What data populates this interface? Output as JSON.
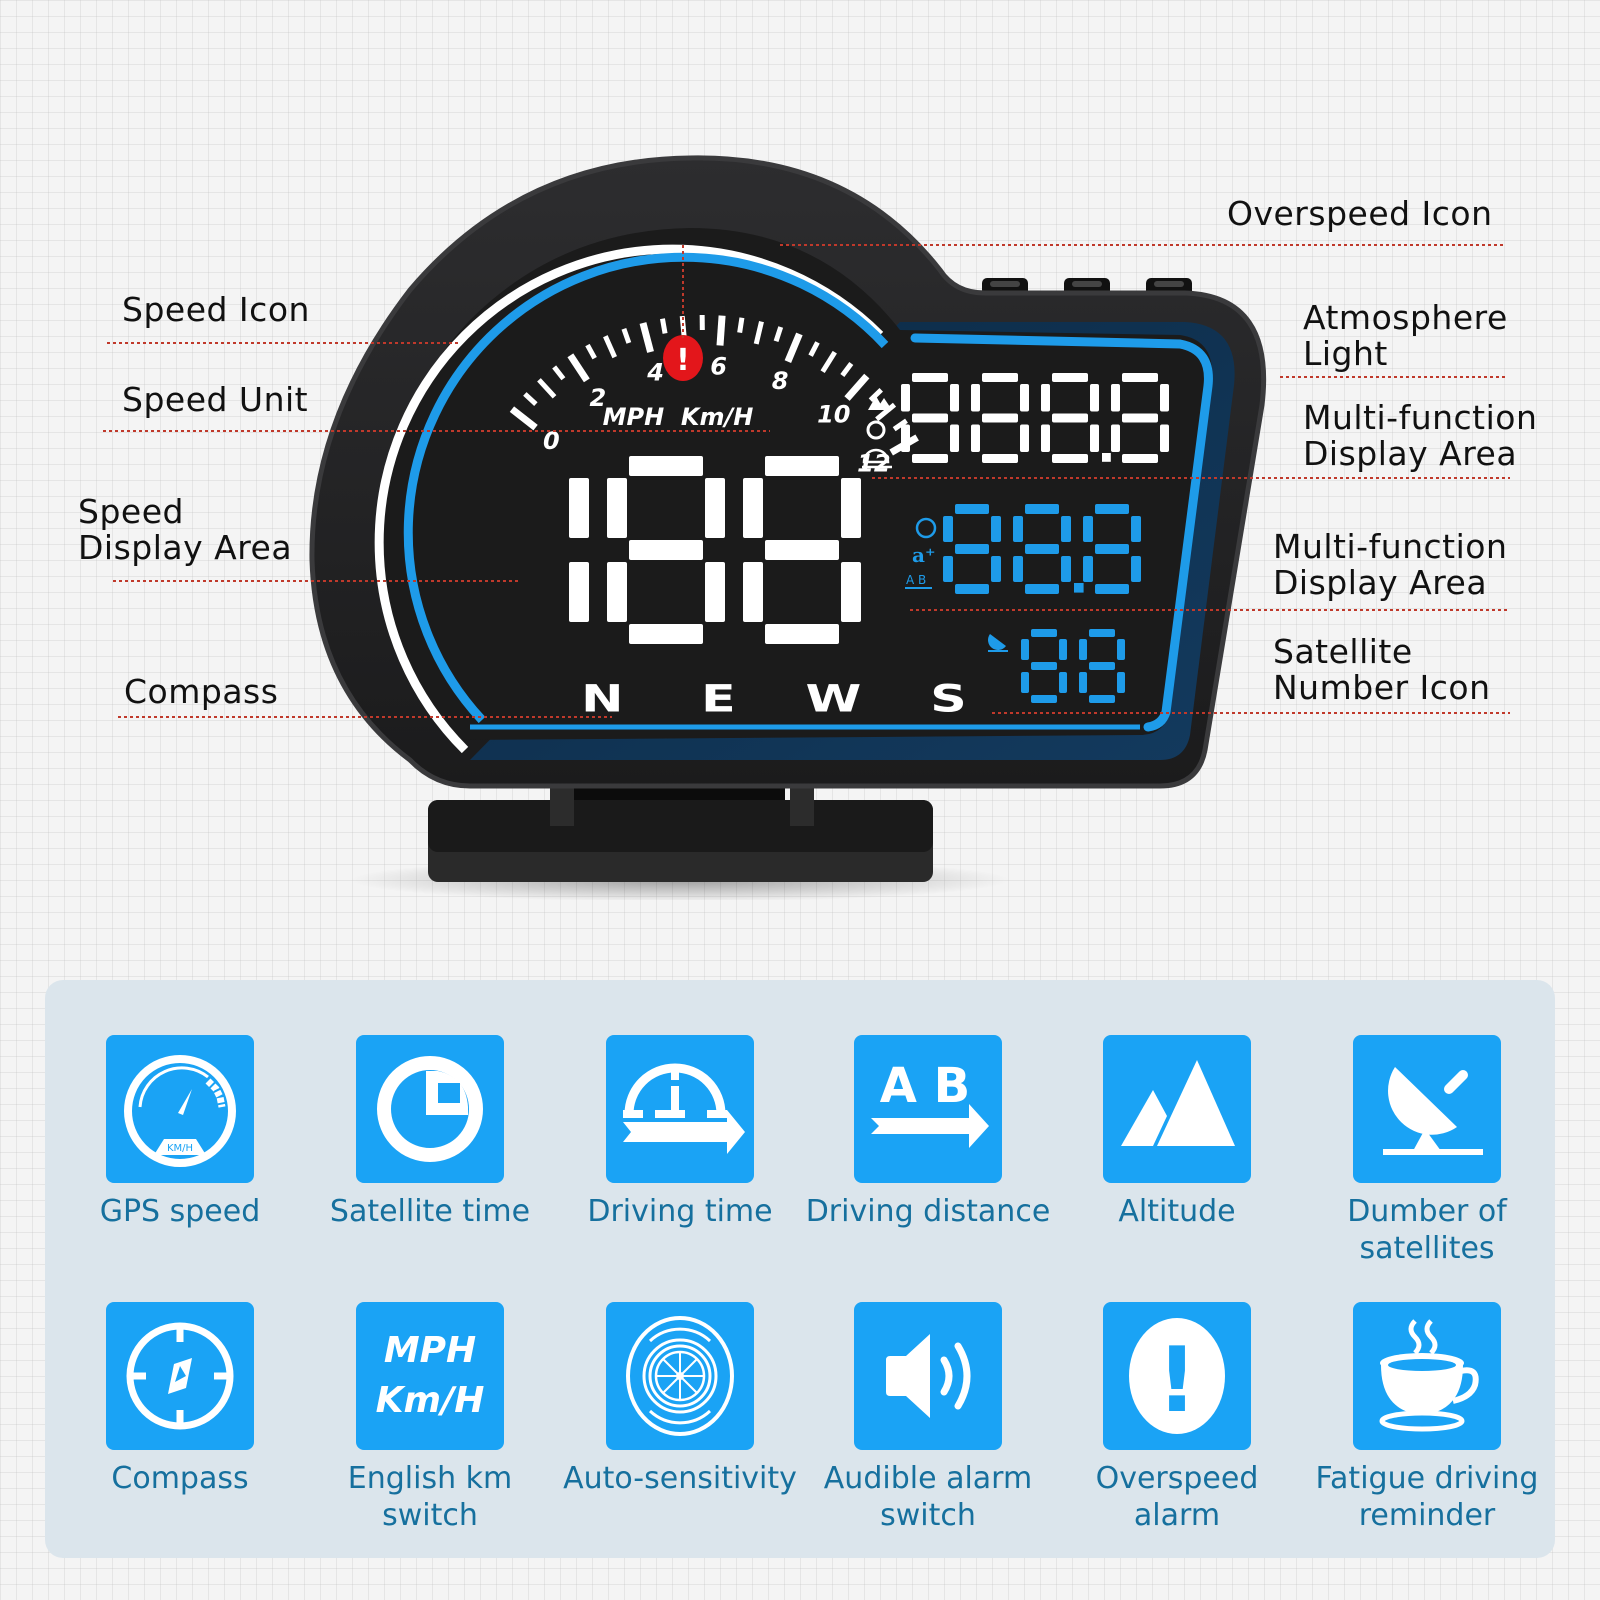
{
  "callouts": {
    "left": [
      {
        "id": "speed-icon",
        "label": "Speed Icon"
      },
      {
        "id": "speed-unit",
        "label": "Speed Unit"
      },
      {
        "id": "speed-display-area",
        "label": "Speed\nDisplay Area"
      },
      {
        "id": "compass",
        "label": "Compass"
      }
    ],
    "right": [
      {
        "id": "overspeed-icon",
        "label": "Overspeed Icon"
      },
      {
        "id": "atmosphere-light",
        "label": "Atmosphere\nLight"
      },
      {
        "id": "multi-function-display-1",
        "label": "Multi-function\nDisplay Area"
      },
      {
        "id": "multi-function-display-2",
        "label": "Multi-function\nDisplay Area"
      },
      {
        "id": "satellite-number-icon",
        "label": "Satellite\nNumber Icon"
      }
    ]
  },
  "device": {
    "gauge_ticks": [
      "0",
      "2",
      "4",
      "6",
      "8",
      "10",
      "12"
    ],
    "unit_label": "MPH  Km/H",
    "speed_digits": "188",
    "compass_letters": [
      "N",
      "E",
      "W",
      "S"
    ],
    "mf1_digits": "888.8",
    "mf2_digits": "88.8",
    "satellite_digits": "88",
    "overspeed_symbol": "!",
    "accent_color": "#1e9be9",
    "alert_color": "#e3161b"
  },
  "features": [
    {
      "icon": "speedometer-icon",
      "label": "GPS speed",
      "icon_text": "KM/H"
    },
    {
      "icon": "clock-icon",
      "label": "Satellite time"
    },
    {
      "icon": "driving-time-icon",
      "label": "Driving time"
    },
    {
      "icon": "ab-distance-icon",
      "label": "Driving distance",
      "icon_text": "A B"
    },
    {
      "icon": "mountain-icon",
      "label": "Altitude"
    },
    {
      "icon": "satellite-dish-icon",
      "label": "Dumber of\nsatellites"
    },
    {
      "icon": "compass-icon",
      "label": "Compass"
    },
    {
      "icon": "unit-switch-icon",
      "label": "English km\nswitch",
      "icon_text": "MPH\nKm/H"
    },
    {
      "icon": "sensitivity-icon",
      "label": "Auto-sensitivity"
    },
    {
      "icon": "speaker-icon",
      "label": "Audible alarm\nswitch"
    },
    {
      "icon": "exclamation-icon",
      "label": "Overspeed\nalarm",
      "icon_text": "!"
    },
    {
      "icon": "coffee-cup-icon",
      "label": "Fatigue driving\nreminder"
    }
  ]
}
